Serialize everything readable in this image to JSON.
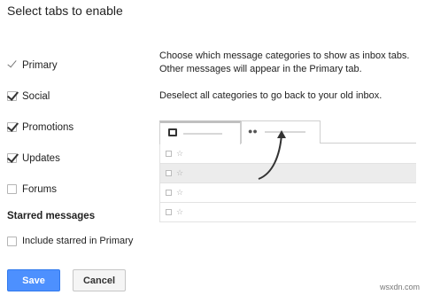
{
  "dialog": {
    "title": "Select tabs to enable"
  },
  "categories": [
    {
      "label": "Primary",
      "state": "locked"
    },
    {
      "label": "Social",
      "state": "checked"
    },
    {
      "label": "Promotions",
      "state": "checked"
    },
    {
      "label": "Updates",
      "state": "checked"
    },
    {
      "label": "Forums",
      "state": "unchecked"
    }
  ],
  "starred": {
    "heading": "Starred messages",
    "option_label": "Include starred in Primary",
    "checked": false
  },
  "description": {
    "line1": "Choose which message categories to show as inbox tabs. Other messages will appear in the Primary tab.",
    "line2": "Deselect all categories to go back to your old inbox."
  },
  "preview": {
    "tab1_icon": "inbox-icon",
    "tab2_icon": "people-icon",
    "row_count": 4,
    "star_glyph": "☆"
  },
  "buttons": {
    "save_label": "Save",
    "cancel_label": "Cancel"
  },
  "colors": {
    "save_bg": "#4d90fe",
    "cancel_bg": "#f5f5f5"
  },
  "watermark": "wsxdn.com"
}
